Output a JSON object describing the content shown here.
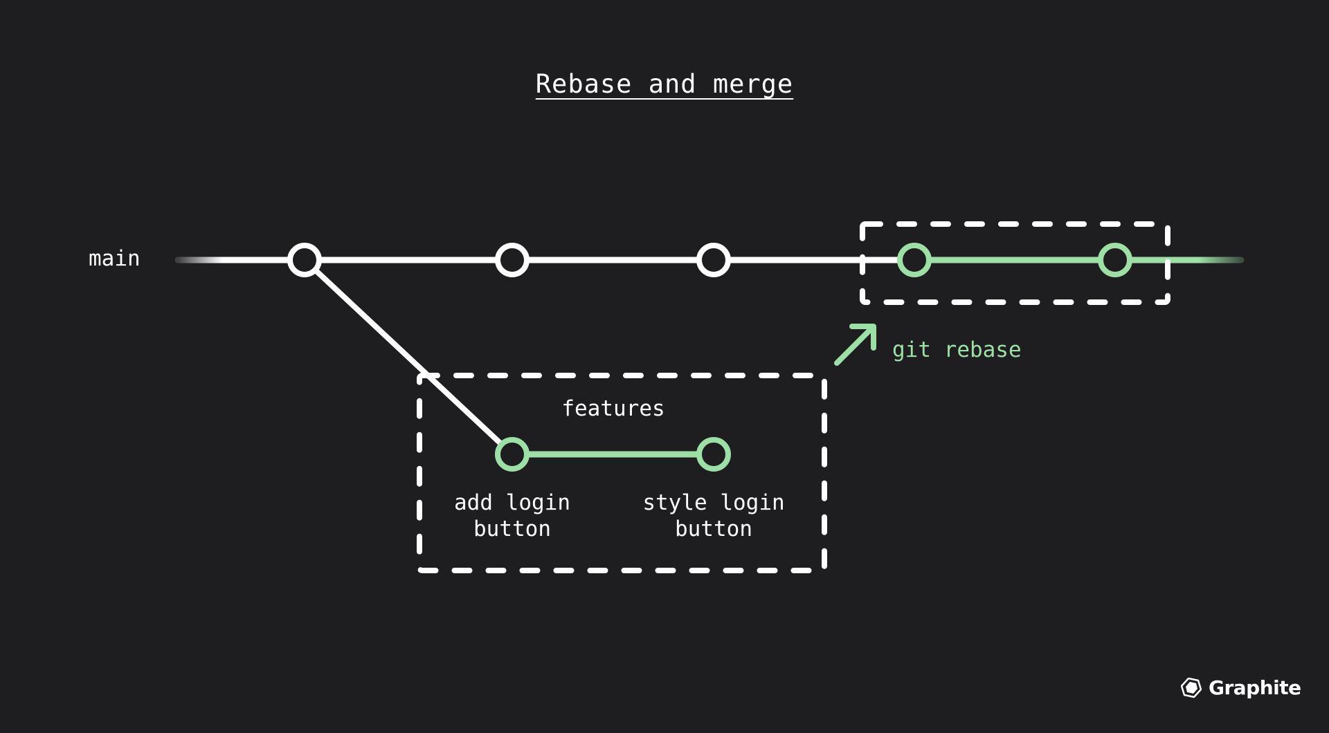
{
  "title": "Rebase and merge",
  "branches": {
    "main": {
      "label": "main",
      "commit_count": 3
    },
    "features": {
      "label": "features",
      "commits": [
        {
          "label": "add login\nbutton"
        },
        {
          "label": "style login\nbutton"
        }
      ]
    },
    "rebased_commits": 2
  },
  "annotation": {
    "label": "git rebase",
    "icon": "arrow-up-right-icon"
  },
  "colors": {
    "background": "#1e1e20",
    "main_line": "#ffffff",
    "feature": "#9de0a6"
  },
  "logo": {
    "text": "Graphite",
    "icon": "graphite-hexagon-icon"
  }
}
